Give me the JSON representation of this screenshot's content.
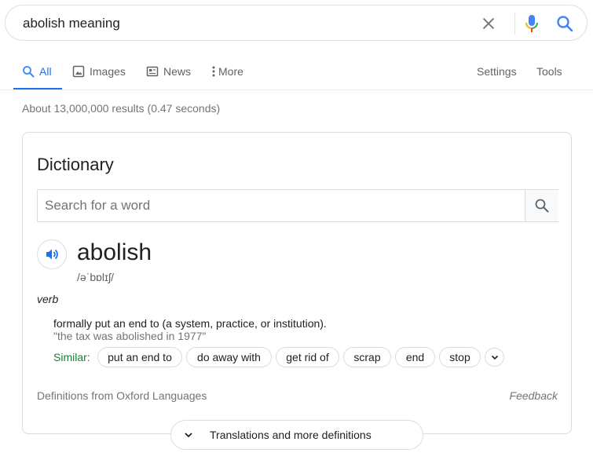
{
  "search": {
    "query": "abolish meaning",
    "icons": {
      "clear": "close-icon",
      "voice": "mic-icon",
      "submit": "search-icon"
    },
    "accent_color": "#1a73e8"
  },
  "tabs": {
    "items": [
      {
        "label": "All",
        "icon": "search-icon",
        "active": true
      },
      {
        "label": "Images",
        "icon": "image-icon",
        "active": false
      },
      {
        "label": "News",
        "icon": "news-icon",
        "active": false
      },
      {
        "label": "More",
        "icon": "more-vert-icon",
        "active": false
      }
    ],
    "settings": "Settings",
    "tools": "Tools"
  },
  "results": {
    "stats": "About 13,000,000 results (0.47 seconds)"
  },
  "dictionary": {
    "title": "Dictionary",
    "search_placeholder": "Search for a word",
    "word": "abolish",
    "phonetic": "/əˈbɒlɪʃ/",
    "part_of_speech": "verb",
    "definition": "formally put an end to (a system, practice, or institution).",
    "example": "\"the tax was abolished in 1977\"",
    "similar_label": "Similar:",
    "similar": [
      "put an end to",
      "do away with",
      "get rid of",
      "scrap",
      "end",
      "stop"
    ],
    "source": "Definitions from Oxford Languages",
    "feedback": "Feedback",
    "more_button": "Translations and more definitions",
    "similar_color": "#188038"
  }
}
